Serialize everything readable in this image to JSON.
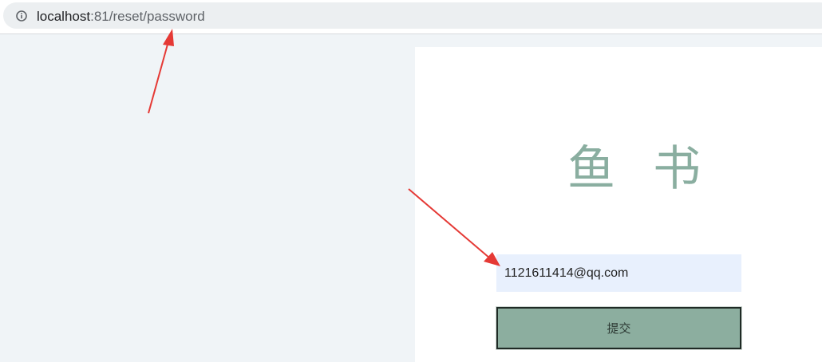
{
  "browser": {
    "url_host": "localhost",
    "url_rest": ":81/reset/password",
    "info_icon": "info-icon"
  },
  "panel": {
    "brand_title": "鱼 书",
    "email_field": {
      "value": "1121611414@qq.com"
    },
    "submit_label": "提交"
  },
  "colors": {
    "brand": "#8aaea0",
    "button_bg": "#8cae9f",
    "input_bg": "#e8f0fd",
    "page_bg": "#f0f4f7",
    "annotation_arrow": "#e53935"
  }
}
